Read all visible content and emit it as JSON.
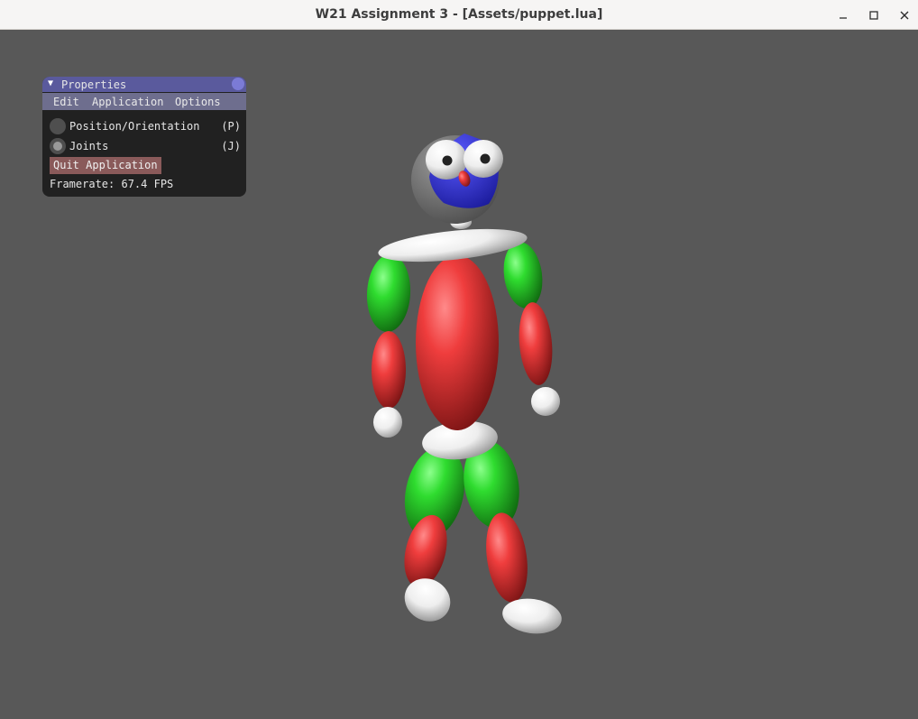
{
  "window": {
    "title": "W21 Assignment 3 - [Assets/puppet.lua]",
    "minimize_icon": "minimize-icon",
    "maximize_icon": "maximize-icon",
    "close_icon": "close-icon"
  },
  "panel": {
    "title": "Properties",
    "collapse_icon": "triangle-down-icon",
    "menu": [
      "Edit",
      "Application",
      "Options"
    ],
    "modes": [
      {
        "label": "Position/Orientation",
        "shortcut": "(P)",
        "selected": false
      },
      {
        "label": "Joints",
        "shortcut": "(J)",
        "selected": true
      }
    ],
    "quit_label": "Quit Application",
    "framerate": "Framerate: 67.4 FPS"
  },
  "colors": {
    "background": "#585858",
    "panel_title": "#5a5a9d",
    "menu_bar": "#6e6e8e",
    "quit_button": "#8a5a5a",
    "puppet_red": "#e03a3a",
    "puppet_green": "#2fcc2f",
    "puppet_blue": "#2a2ad8",
    "puppet_white": "#f2f2f2"
  }
}
